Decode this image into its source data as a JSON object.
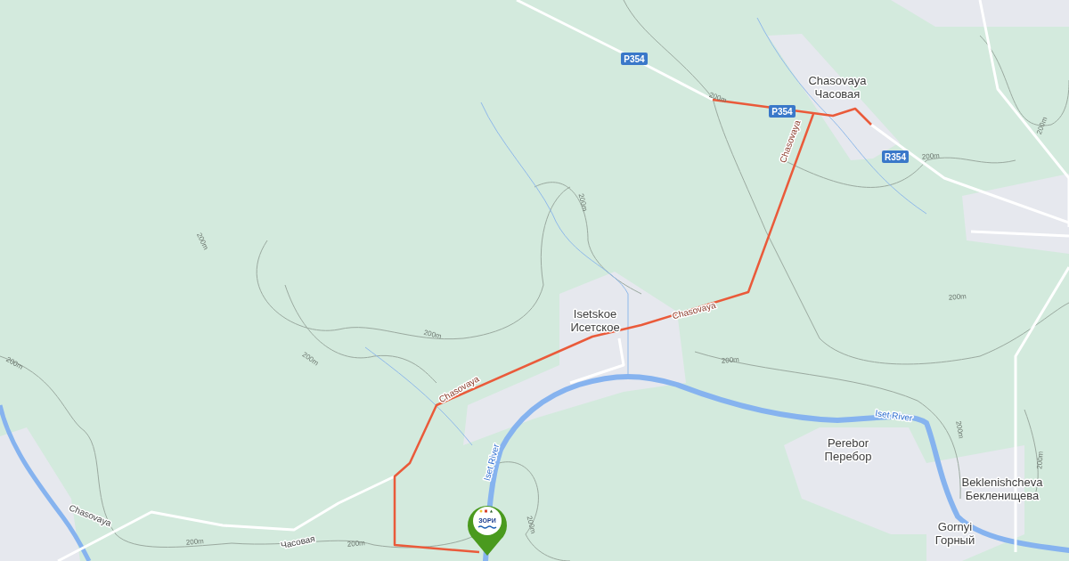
{
  "map": {
    "settlements": [
      {
        "name": "Chasovaya",
        "name_local": "Часовая"
      },
      {
        "name": "Isetskoe",
        "name_local": "Исетское"
      },
      {
        "name": "Perebor",
        "name_local": "Перебор"
      },
      {
        "name": "Beklenishcheva",
        "name_local": "Бекленищева"
      },
      {
        "name": "Gornyi",
        "name_local": "Горный"
      }
    ],
    "road_shields": [
      "Р354",
      "Р354",
      "R354"
    ],
    "road_labels": [
      {
        "text": "Chasovaya",
        "on_route": true
      },
      {
        "text": "Chasovaya",
        "on_route": true
      },
      {
        "text": "Chasovaya",
        "on_route": true
      },
      {
        "text": "Chasovaya",
        "on_route": false
      },
      {
        "text": "Часовая",
        "on_route": false
      }
    ],
    "river_labels": [
      "Iset River",
      "Iset River"
    ],
    "contour_labels": [
      "200m",
      "200m",
      "200m",
      "200m",
      "200m",
      "200m",
      "200m",
      "200m",
      "200m",
      "200m",
      "200m",
      "200m",
      "200m",
      "200m",
      "200m"
    ],
    "marker": {
      "logo_text": "ЗОРИ"
    }
  }
}
